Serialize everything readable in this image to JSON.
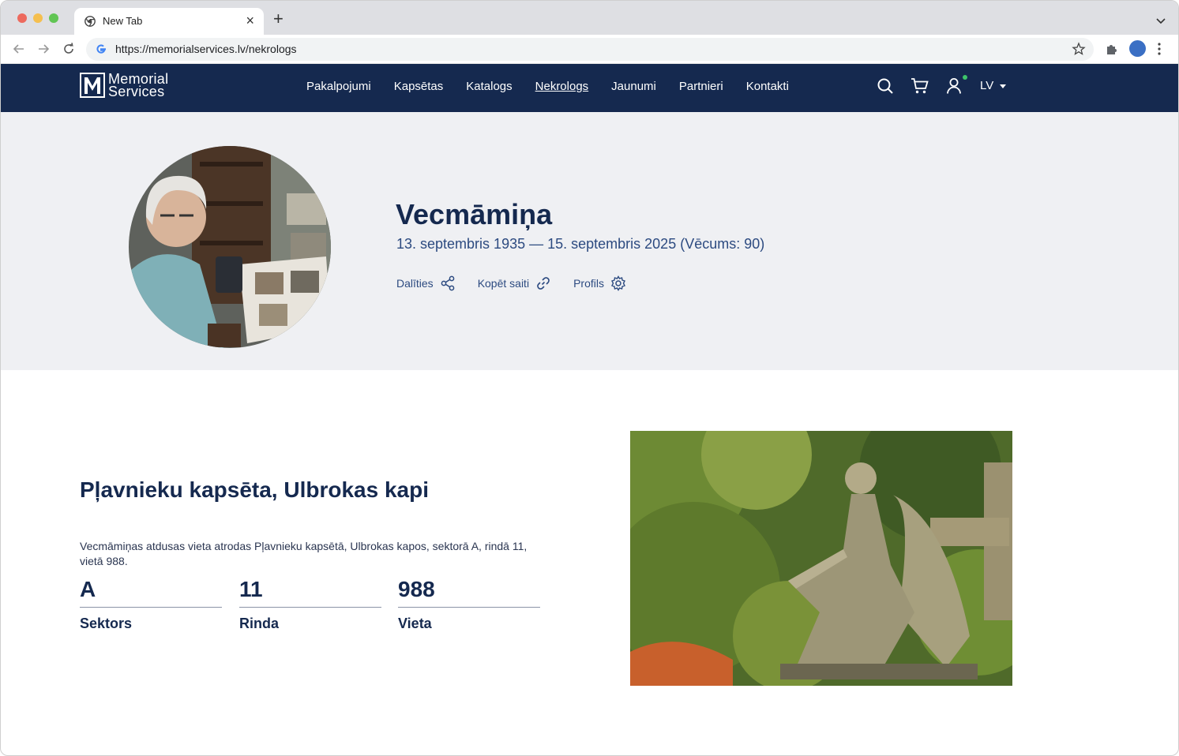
{
  "browser": {
    "tab_title": "New Tab",
    "url": "https://memorialservices.lv/nekrologs"
  },
  "site": {
    "logo_line1": "Memorial",
    "logo_line2": "Services",
    "nav": [
      "Pakalpojumi",
      "Kapsētas",
      "Katalogs",
      "Nekrologs",
      "Jaunumi",
      "Partnieri",
      "Kontakti"
    ],
    "active_nav": "Nekrologs",
    "language": "LV"
  },
  "profile": {
    "name": "Vecmāmiņa",
    "dates": "13. septembris 1935 — 15. septembris 2025 (Vēcums: 90)",
    "actions": {
      "share": "Dalīties",
      "copy_link": "Kopēt saiti",
      "profile": "Profils"
    }
  },
  "cemetery": {
    "title": "Pļavnieku kapsēta, Ulbrokas kapi",
    "description": "Vecmāmiņas atdusas vieta atrodas Pļavnieku kapsētā, Ulbrokas kapos, sektorā A, rindā 11, vietā 988.",
    "sector": {
      "value": "A",
      "label": "Sektors"
    },
    "row": {
      "value": "11",
      "label": "Rinda"
    },
    "place": {
      "value": "988",
      "label": "Vieta"
    }
  },
  "colors": {
    "brand_navy": "#15294f",
    "hero_bg": "#eff0f3",
    "accent_text": "#2c4a80"
  }
}
